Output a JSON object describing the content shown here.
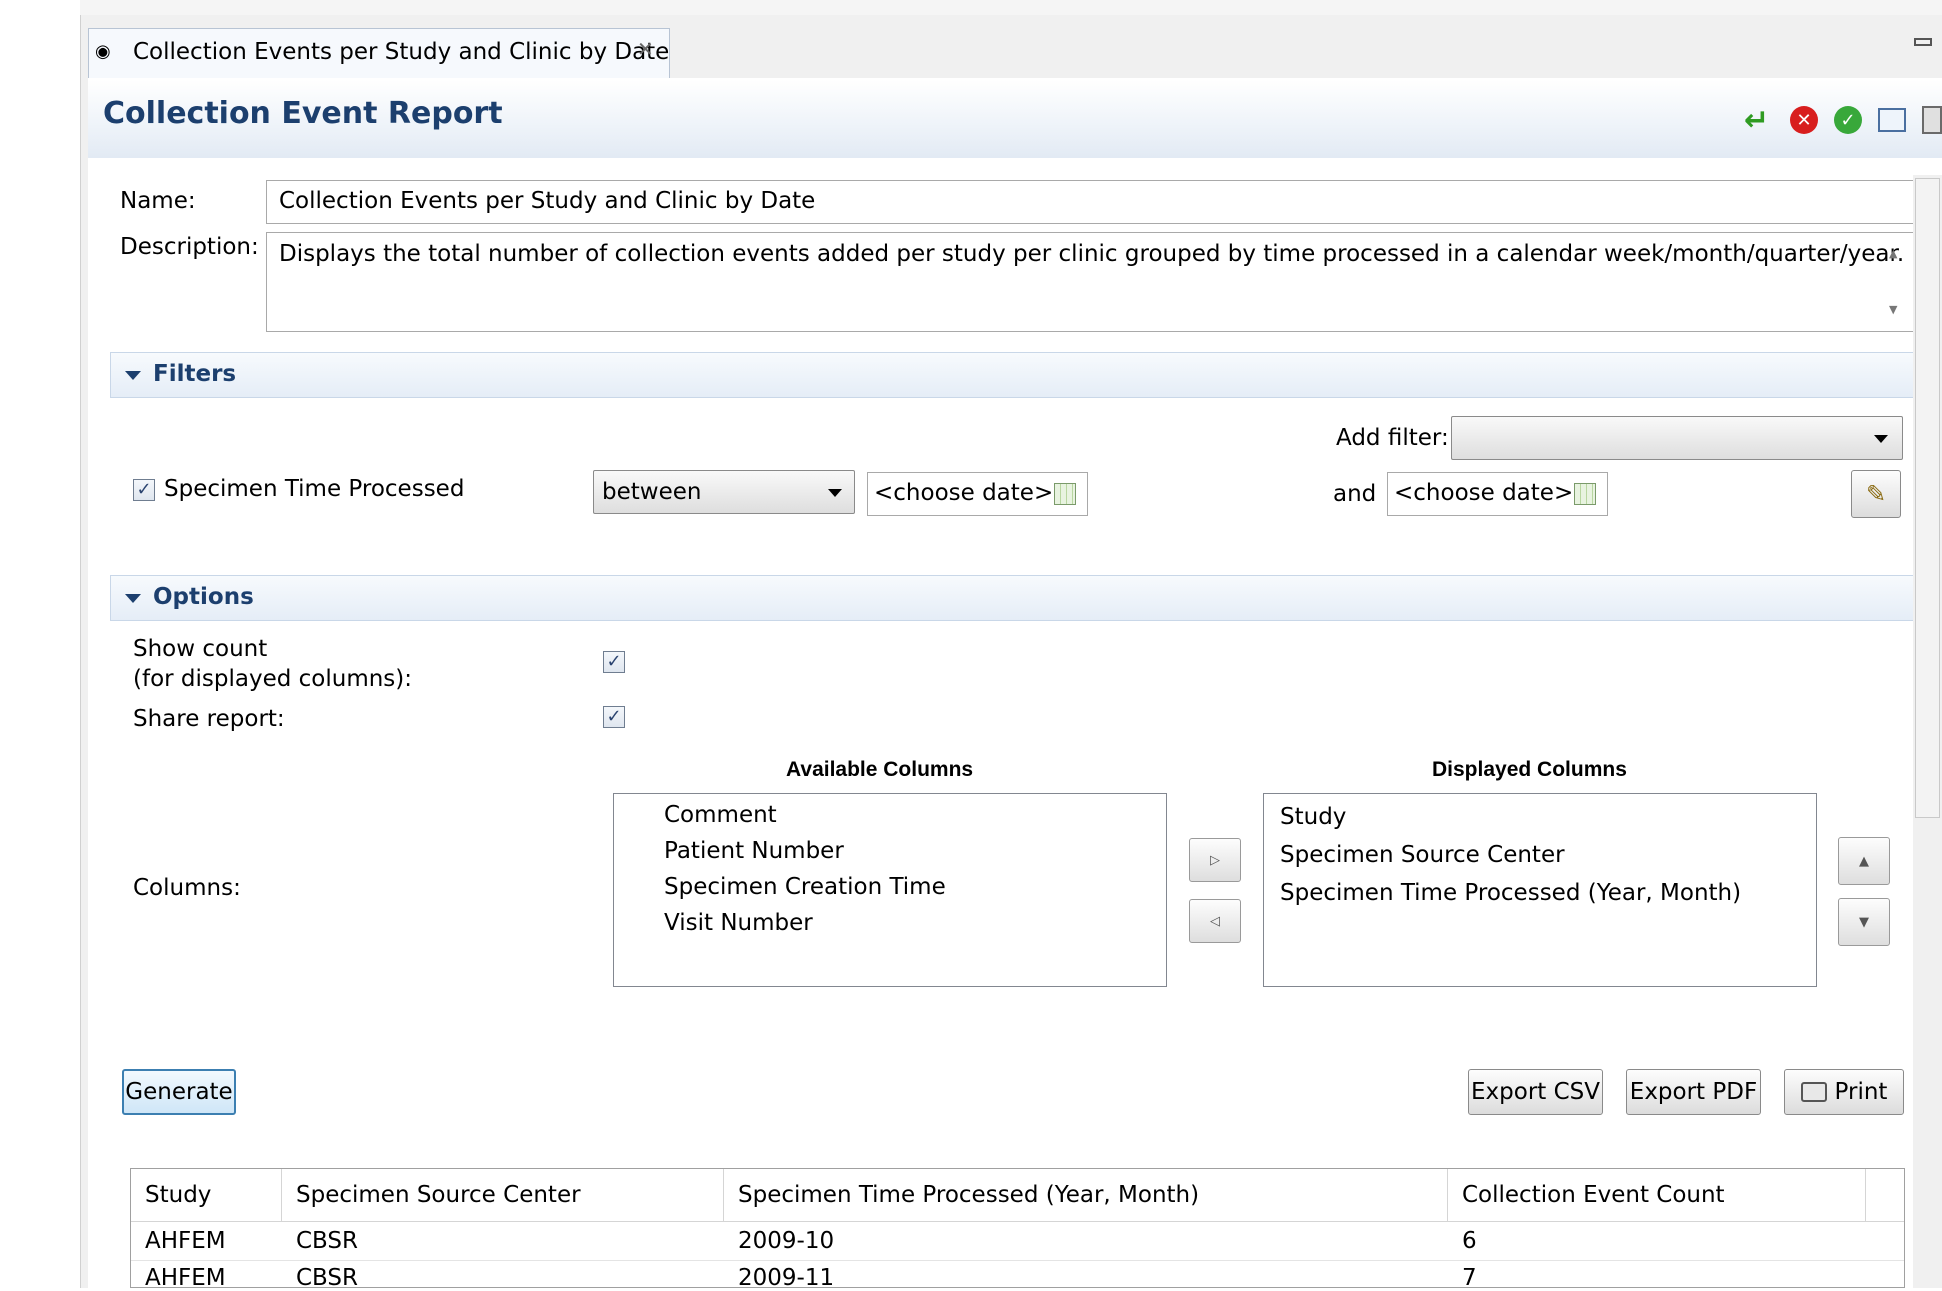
{
  "tab": {
    "label": "Collection Events per Study and Clinic by Date"
  },
  "header": {
    "title": "Collection Event Report"
  },
  "form": {
    "name_label": "Name:",
    "name_value": "Collection Events per Study and Clinic by Date",
    "description_label": "Description:",
    "description_value": "Displays the total number of collection events added per study per clinic grouped by time processed in a calendar week/month/quarter/year."
  },
  "filters": {
    "section_label": "Filters",
    "add_filter_label": "Add filter:",
    "add_filter_value": "",
    "filter_label": "Specimen Time Processed",
    "filter_checked": true,
    "operator": "between",
    "date_from_placeholder": "<choose date>",
    "and_label": "and",
    "date_to_placeholder": "<choose date>"
  },
  "options": {
    "section_label": "Options",
    "show_count_label_line1": "Show count",
    "show_count_label_line2": "(for displayed columns):",
    "show_count_checked": true,
    "share_report_label": "Share report:",
    "share_report_checked": true,
    "columns_label": "Columns:",
    "available_title": "Available Columns",
    "available": [
      "Comment",
      "Patient Number",
      "Specimen Creation Time",
      "Visit Number"
    ],
    "displayed_title": "Displayed Columns",
    "displayed": [
      "Study",
      "Specimen Source Center",
      "Specimen Time Processed (Year, Month)"
    ]
  },
  "actions": {
    "generate": "Generate",
    "export_csv": "Export CSV",
    "export_pdf": "Export PDF",
    "print": "Print"
  },
  "results": {
    "headers": [
      "Study",
      "Specimen Source Center",
      "Specimen Time Processed (Year, Month)",
      "Collection Event Count"
    ],
    "rows": [
      [
        "AHFEM",
        "CBSR",
        "2009-10",
        "6"
      ],
      [
        "AHFEM",
        "CBSR",
        "2009-11",
        "7"
      ]
    ]
  },
  "colors": {
    "title": "#1c3f6e",
    "section_bg": "#e5edf7",
    "default_button_border": "#3c7fb1"
  },
  "icons": [
    "binoculars-icon",
    "close-tab-icon",
    "minimize-icon",
    "reset-icon",
    "cancel-icon",
    "confirm-icon",
    "export-icon",
    "print-icon",
    "calendar-icon",
    "wand-icon",
    "move-right-icon",
    "move-left-icon",
    "move-up-icon",
    "move-down-icon"
  ]
}
